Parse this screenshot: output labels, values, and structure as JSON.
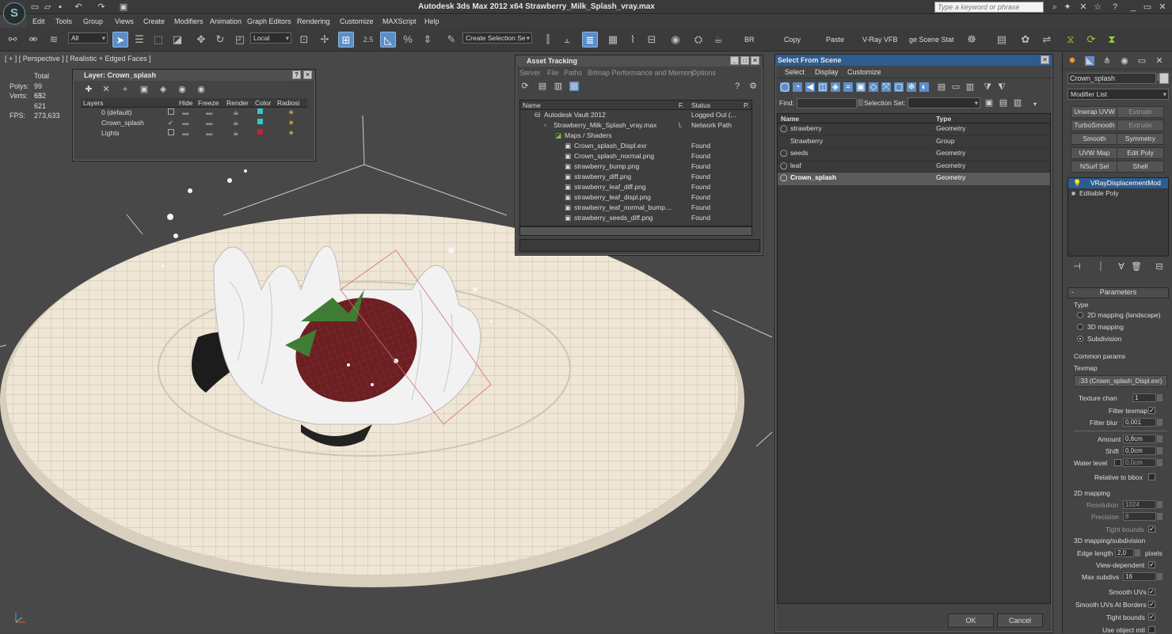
{
  "app": {
    "title": "Autodesk 3ds Max  2012 x64     Strawberry_Milk_Splash_vray.max",
    "logo": "3ds-max-logo",
    "search_placeholder": "Type a keyword or phrase"
  },
  "menu": [
    "Edit",
    "Tools",
    "Group",
    "Views",
    "Create",
    "Modifiers",
    "Animation",
    "Graph Editors",
    "Rendering",
    "Customize",
    "MAXScript",
    "Help"
  ],
  "toolbar": {
    "filter": "All",
    "coord": "Local",
    "snap_value": "2.5",
    "selection_set": "Create Selection Se",
    "labels": [
      "BR",
      "Copy",
      "Paste",
      "V-Ray VFB",
      "ge Scene Stat"
    ]
  },
  "viewport": {
    "label": "[ + ] [ Perspective ] [ Realistic + Edged Faces ]",
    "stats": {
      "total_label": "Total",
      "polys_label": "Polys:",
      "polys": "99 652",
      "verts_label": "Verts:",
      "verts": "63 621",
      "fps_label": "FPS:",
      "fps": "273,633"
    }
  },
  "layer_win": {
    "title": "Layer: Crown_splash",
    "columns": [
      "Layers",
      "Hide",
      "Freeze",
      "Render",
      "Color",
      "Radiosi"
    ],
    "rows": [
      {
        "name": "0 (default)",
        "color": "#2fc8c8"
      },
      {
        "name": "Crown_splash",
        "color": "#2fc8c8"
      },
      {
        "name": "Lights",
        "color": "#c8203c"
      }
    ]
  },
  "asset_win": {
    "title": "Asset Tracking",
    "menu": [
      "Server",
      "File",
      "Paths",
      "Bitmap Performance and Memory",
      "Options"
    ],
    "columns": [
      "Name",
      "F.",
      "Status",
      "P."
    ],
    "rows": [
      {
        "name": "Autodesk Vault 2012",
        "f": "",
        "status": "Logged Out (..."
      },
      {
        "name": "Strawberry_Milk_Splash_vray.max",
        "f": "\\.",
        "status": "Network Path"
      },
      {
        "name": "Maps / Shaders",
        "f": "",
        "status": ""
      },
      {
        "name": "Crown_splash_Displ.exr",
        "f": "",
        "status": "Found"
      },
      {
        "name": "Crown_splash_normal.png",
        "f": "",
        "status": "Found"
      },
      {
        "name": "strawberry_bump.png",
        "f": "",
        "status": "Found"
      },
      {
        "name": "strawberry_diff.png",
        "f": "",
        "status": "Found"
      },
      {
        "name": "strawberry_leaf_diff.png",
        "f": "",
        "status": "Found"
      },
      {
        "name": "strawberry_leaf_displ.png",
        "f": "",
        "status": "Found"
      },
      {
        "name": "strawberry_leaf_normal_bump....",
        "f": "",
        "status": "Found"
      },
      {
        "name": "strawberry_seeds_diff.png",
        "f": "",
        "status": "Found"
      }
    ]
  },
  "scene_win": {
    "title": "Select From Scene",
    "menu": [
      "Select",
      "Display",
      "Customize"
    ],
    "find_label": "Find:",
    "selset_label": "Selection Set:",
    "columns": [
      "Name",
      "Type"
    ],
    "rows": [
      {
        "name": "strawberry",
        "type": "Geometry"
      },
      {
        "name": "Strawberry",
        "type": "Group"
      },
      {
        "name": "seeds",
        "type": "Geometry"
      },
      {
        "name": "leaf",
        "type": "Geometry"
      },
      {
        "name": "Crown_splash",
        "type": "Geometry"
      }
    ],
    "ok": "OK",
    "cancel": "Cancel"
  },
  "cmd": {
    "object_name": "Crown_splash",
    "modifier_list": "Modifier List",
    "buttons": [
      "Unwrap UVW",
      "Extrude",
      "TurboSmooth",
      "Extrude",
      "Smooth",
      "Symmetry",
      "UVW Map",
      "Edit Poly",
      "NSurf Sel",
      "Shell"
    ],
    "stack": [
      "VRayDisplacementMod",
      "Editable Poly"
    ],
    "params": {
      "header": "Parameters",
      "type_label": "Type",
      "types": [
        "2D mapping (landscape)",
        "3D mapping",
        "Subdivision"
      ],
      "common": "Common params",
      "texmap_label": "Texmap",
      "texmap": ":33 (Crown_splash_Displ.exr)",
      "texture_chan_label": "Texture chan",
      "texture_chan": "1",
      "filter_texmap": "Filter texmap",
      "filter_blur_label": "Filter blur",
      "filter_blur": "0,001",
      "amount_label": "Amount",
      "amount": "0,8cm",
      "shift_label": "Shift",
      "shift": "0,0cm",
      "water_label": "Water level",
      "water": "0,0cm",
      "rel_bbox": "Relative to bbox",
      "mapping2d": "2D mapping",
      "resolution_label": "Resolution",
      "resolution": "1024",
      "precision_label": "Precision",
      "precision": "8",
      "tight_bounds": "Tight bounds",
      "mapping3d": "3D mapping/subdivision",
      "edge_label": "Edge length",
      "edge": "2,0",
      "pixels": "pixels",
      "view_dep": "View-dependent",
      "max_sub_label": "Max subdivs",
      "max_sub": "16",
      "smooth_uvs": "Smooth UVs",
      "smooth_uvs_borders": "Smooth UVs At Borders",
      "tight_bounds2": "Tight bounds",
      "use_object_mtl": "Use object mtl"
    }
  }
}
